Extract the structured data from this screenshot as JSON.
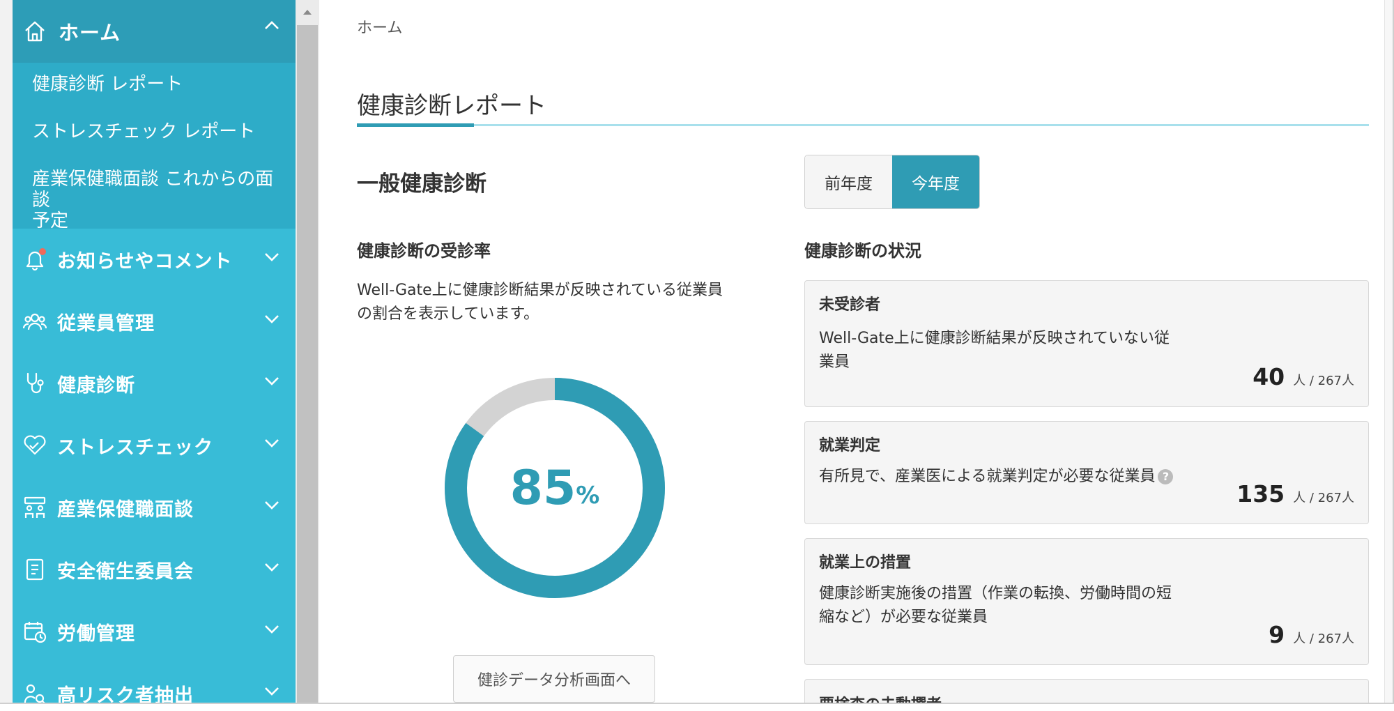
{
  "sidebar": {
    "header": {
      "label": "ホーム",
      "icon": "home-icon"
    },
    "sub_items": [
      {
        "label": "健康診断 レポート"
      },
      {
        "label": "ストレスチェック レポート"
      },
      {
        "label_line1": "産業保健職面談 これからの面談",
        "label_line2": "予定"
      }
    ],
    "items": [
      {
        "label": "お知らせやコメント",
        "icon": "bell-icon"
      },
      {
        "label": "従業員管理",
        "icon": "people-icon"
      },
      {
        "label": "健康診断",
        "icon": "stethoscope-icon"
      },
      {
        "label": "ストレスチェック",
        "icon": "heart-icon"
      },
      {
        "label": "産業保健職面談",
        "icon": "meeting-icon"
      },
      {
        "label": "安全衛生委員会",
        "icon": "document-icon"
      },
      {
        "label": "労働管理",
        "icon": "calendar-clock-icon"
      },
      {
        "label": "高リスク者抽出",
        "icon": "person-search-icon"
      }
    ]
  },
  "main": {
    "breadcrumb": "ホーム",
    "page_title": "健康診断レポート",
    "section_title": "一般健康診断",
    "year_toggle": {
      "prev_label": "前年度",
      "current_label": "今年度",
      "selected": "今年度"
    },
    "rate": {
      "heading": "健康診断の受診率",
      "desc_line1": "Well-Gate上に健康診断結果が反映されている従業員",
      "desc_line2": "の割合を表示しています。",
      "value": "85",
      "unit": "%",
      "fraction": 0.85
    },
    "analysis_button": "健診データ分析画面へ",
    "status": {
      "heading": "健康診断の状況",
      "cards": [
        {
          "title": "未受診者",
          "desc_line1": "Well-Gate上に健康診断結果が反映されていない従",
          "desc_line2": "業員",
          "count": "40",
          "unit": "人 / 267人"
        },
        {
          "title": "就業判定",
          "desc_line1": "有所見で、産業医による就業判定が必要な従業員",
          "desc_line2": "",
          "count": "135",
          "unit": "人 / 267人"
        },
        {
          "title": "就業上の措置",
          "desc_line1": "健康診断実施後の措置（作業の転換、労働時間の短",
          "desc_line2": "縮など）が必要な従業員",
          "count": "9",
          "unit": "人 / 267人"
        },
        {
          "title": "要検査の未動撰者"
        }
      ]
    }
  },
  "colors": {
    "sidebar_bg": "#38bcd7",
    "sidebar_header_bg": "#2d9db7",
    "accent": "#2f9cb4",
    "donut_remainder": "#d3d3d3"
  }
}
